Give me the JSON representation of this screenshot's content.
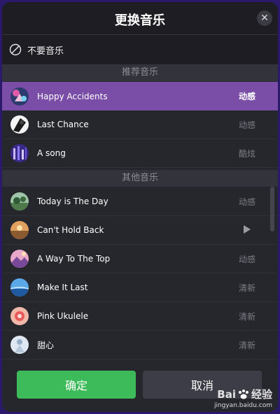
{
  "dialog": {
    "title": "更换音乐",
    "close_symbol": "✕",
    "no_music_label": "不要音乐",
    "recommended_section": "推荐音乐",
    "other_section": "其他音乐",
    "recommended": [
      {
        "name": "Happy Accidents",
        "tag": "动感",
        "selected": true
      },
      {
        "name": "Last Chance",
        "tag": "动感"
      },
      {
        "name": "A song",
        "tag": "酷炫"
      }
    ],
    "other": [
      {
        "name": "Today is The Day",
        "tag": "动感"
      },
      {
        "name": "Can't Hold Back",
        "tag": "",
        "icon": "play-icon"
      },
      {
        "name": "A Way To The Top",
        "tag": "动感"
      },
      {
        "name": "Make It Last",
        "tag": "清新"
      },
      {
        "name": "Pink Ukulele",
        "tag": "清新"
      },
      {
        "name": "甜心",
        "tag": "清新"
      }
    ],
    "confirm_label": "确定",
    "cancel_label": "取消"
  },
  "watermark": {
    "brand_left": "Bai",
    "brand_right": "经验",
    "url": "jingyan.baidu.com"
  },
  "colors": {
    "accent_selected": "#7a4ea6",
    "confirm_green": "#3dba5a",
    "background": "#26262d"
  }
}
